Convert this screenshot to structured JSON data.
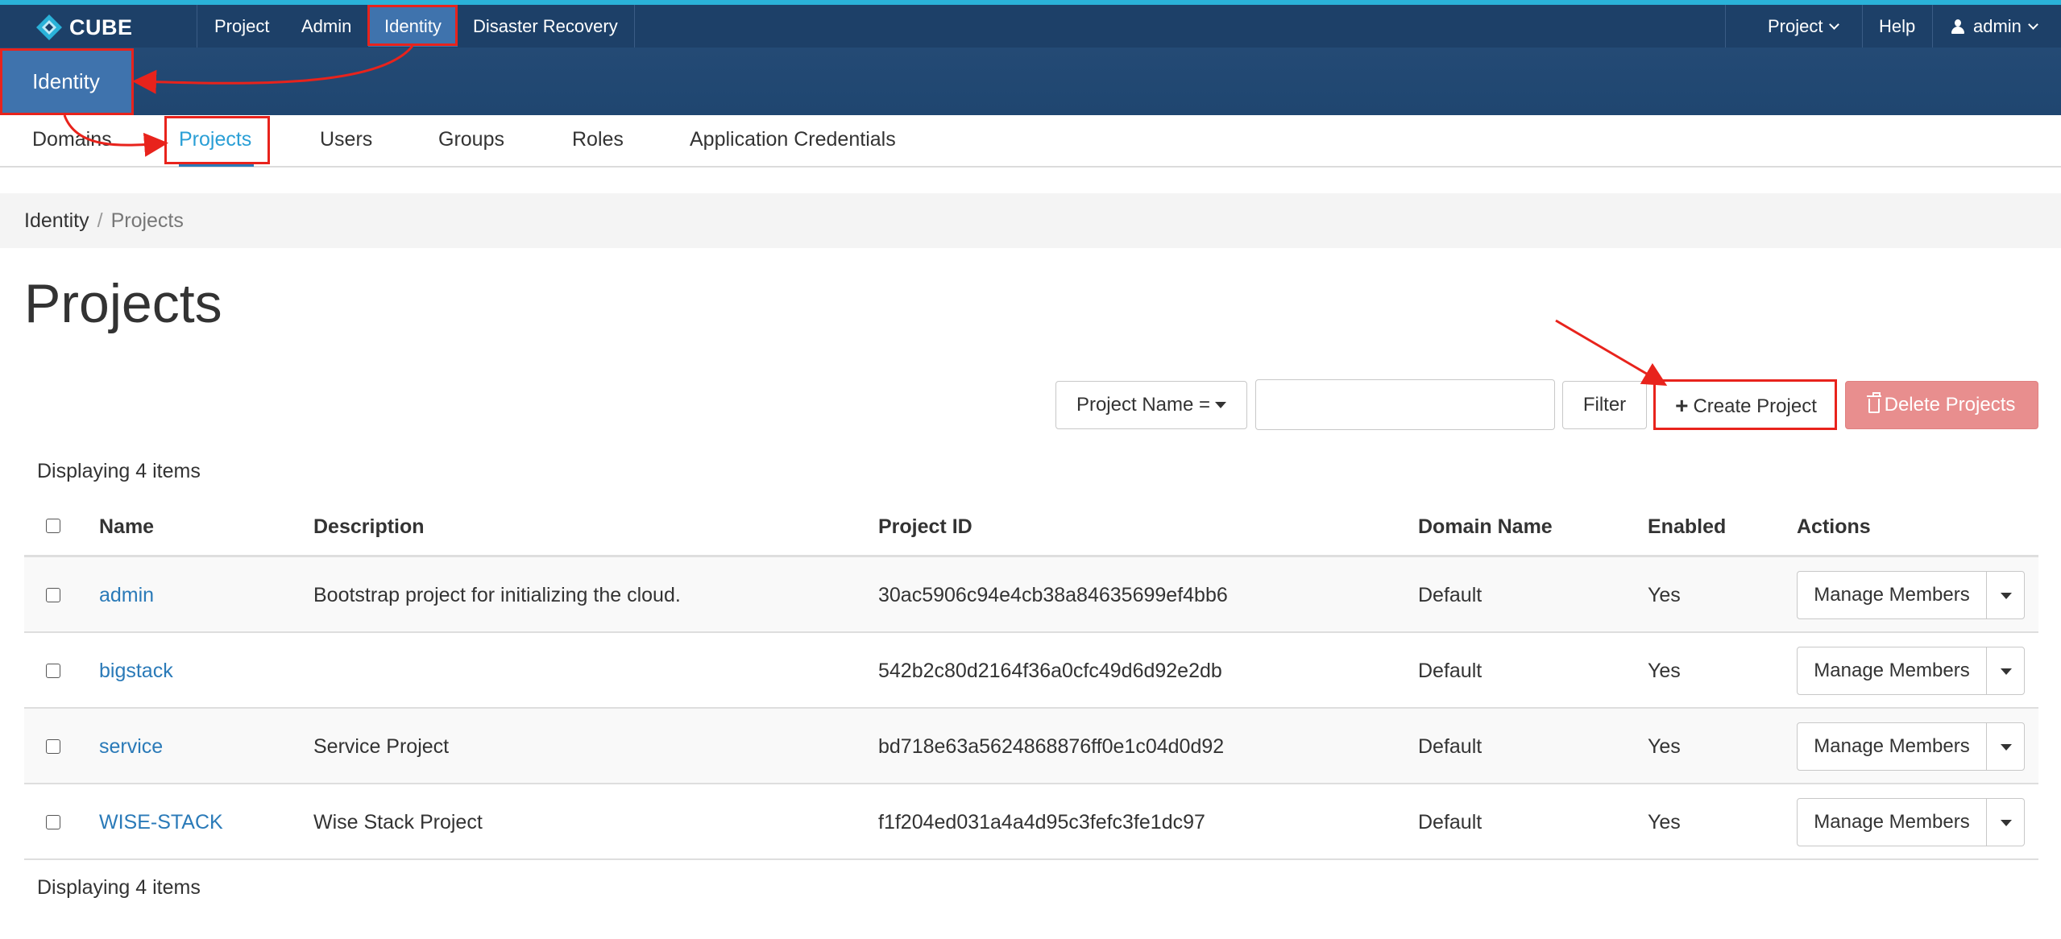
{
  "brand": {
    "name": "CUBE"
  },
  "navbar": {
    "items": [
      {
        "label": "Project"
      },
      {
        "label": "Admin"
      },
      {
        "label": "Identity"
      },
      {
        "label": "Disaster Recovery"
      }
    ],
    "right": {
      "project_menu": "Project",
      "help": "Help",
      "user": "admin"
    }
  },
  "panel": {
    "active": "Identity"
  },
  "tabs": [
    {
      "label": "Domains"
    },
    {
      "label": "Projects"
    },
    {
      "label": "Users"
    },
    {
      "label": "Groups"
    },
    {
      "label": "Roles"
    },
    {
      "label": "Application Credentials"
    }
  ],
  "breadcrumb": {
    "parent": "Identity",
    "separator": "/",
    "current": "Projects"
  },
  "page": {
    "title": "Projects"
  },
  "filter": {
    "select_label": "Project Name =",
    "input_value": "",
    "filter_label": "Filter",
    "create_label": "Create Project",
    "delete_label": "Delete Projects"
  },
  "table": {
    "count_text": "Displaying 4 items",
    "columns": [
      "Name",
      "Description",
      "Project ID",
      "Domain Name",
      "Enabled",
      "Actions"
    ],
    "rows": [
      {
        "name": "admin",
        "description": "Bootstrap project for initializing the cloud.",
        "project_id": "30ac5906c94e4cb38a84635699ef4bb6",
        "domain": "Default",
        "enabled": "Yes",
        "action": "Manage Members"
      },
      {
        "name": "bigstack",
        "description": "",
        "project_id": "542b2c80d2164f36a0cfc49d6d92e2db",
        "domain": "Default",
        "enabled": "Yes",
        "action": "Manage Members"
      },
      {
        "name": "service",
        "description": "Service Project",
        "project_id": "bd718e63a5624868876ff0e1c04d0d92",
        "domain": "Default",
        "enabled": "Yes",
        "action": "Manage Members"
      },
      {
        "name": "WISE-STACK",
        "description": "Wise Stack Project",
        "project_id": "f1f204ed031a4a4d95c3fefc3fe1dc97",
        "domain": "Default",
        "enabled": "Yes",
        "action": "Manage Members"
      }
    ]
  },
  "colors": {
    "navbar": "#1d4068",
    "accent_top": "#2ab2d9",
    "active_nav": "#3f73ad",
    "link": "#2a7ab8",
    "danger": "#e88e8e",
    "annotation": "#e8231c"
  }
}
